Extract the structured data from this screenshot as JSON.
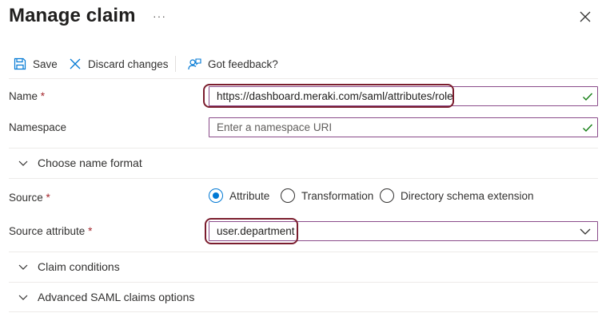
{
  "header": {
    "title": "Manage claim",
    "more_label": "···"
  },
  "toolbar": {
    "save_label": "Save",
    "discard_label": "Discard changes",
    "feedback_label": "Got feedback?"
  },
  "form": {
    "name": {
      "label": "Name",
      "required_mark": "*",
      "value": "https://dashboard.meraki.com/saml/attributes/role"
    },
    "namespace": {
      "label": "Namespace",
      "placeholder": "Enter a namespace URI"
    },
    "name_format_section": "Choose name format",
    "source": {
      "label": "Source",
      "required_mark": "*",
      "options": [
        {
          "label": "Attribute",
          "selected": true
        },
        {
          "label": "Transformation",
          "selected": false
        },
        {
          "label": "Directory schema extension",
          "selected": false
        }
      ]
    },
    "source_attribute": {
      "label": "Source attribute",
      "required_mark": "*",
      "value": "user.department"
    },
    "claim_conditions_section": "Claim conditions",
    "advanced_section": "Advanced SAML claims options"
  },
  "colors": {
    "accent": "#0078d4",
    "field_border": "#8a4b8a",
    "valid_check": "#107c10",
    "required": "#a4262c",
    "highlight": "#7b1d2e"
  }
}
